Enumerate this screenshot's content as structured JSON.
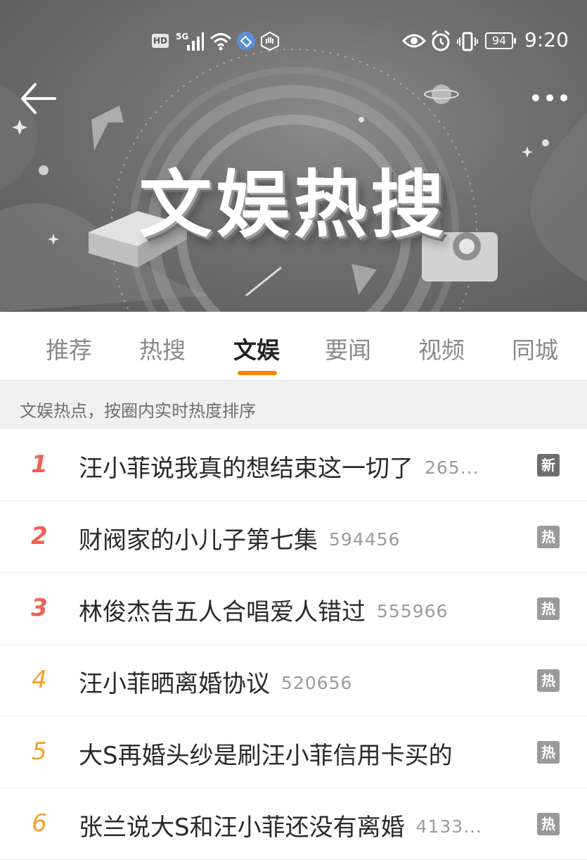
{
  "status_bar": {
    "hd": "HD",
    "network": "5G",
    "battery": "94",
    "time": "9:20"
  },
  "banner": {
    "title": "文娱热搜"
  },
  "tabs": [
    {
      "label": "推荐",
      "active": false
    },
    {
      "label": "热搜",
      "active": false
    },
    {
      "label": "文娱",
      "active": true
    },
    {
      "label": "要闻",
      "active": false
    },
    {
      "label": "视频",
      "active": false
    },
    {
      "label": "同城",
      "active": false
    }
  ],
  "colors": {
    "accent": "#ff8200",
    "rank_top": "#f06155",
    "rank_other": "#f5a02a"
  },
  "subheader": "文娱热点，按圈内实时热度排序",
  "list": [
    {
      "rank": "1",
      "title": "汪小菲说我真的想结束这一切了",
      "count": "265...",
      "badge": "新"
    },
    {
      "rank": "2",
      "title": "财阀家的小儿子第七集",
      "count": "594456",
      "badge": "热"
    },
    {
      "rank": "3",
      "title": "林俊杰告五人合唱爱人错过",
      "count": "555966",
      "badge": "热"
    },
    {
      "rank": "4",
      "title": "汪小菲晒离婚协议",
      "count": "520656",
      "badge": "热"
    },
    {
      "rank": "5",
      "title": "大S再婚头纱是刷汪小菲信用卡买的",
      "count": "",
      "badge": "热"
    },
    {
      "rank": "6",
      "title": "张兰说大S和汪小菲还没有离婚",
      "count": "4133...",
      "badge": "热"
    }
  ]
}
